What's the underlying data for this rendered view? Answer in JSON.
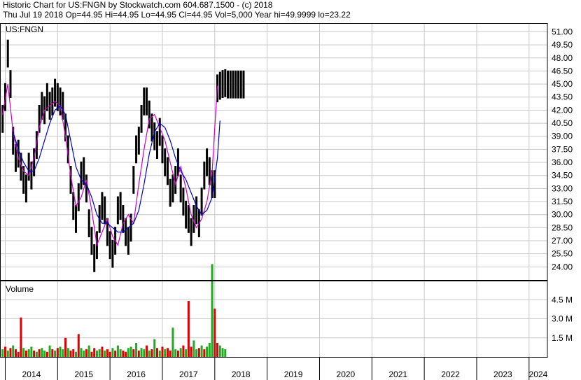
{
  "header": {
    "line1": "Historic Chart for US:FNGN by Stockwatch.com 604.687.1500 - (c) 2018",
    "line2": "Thu Jul 19 2018   Op=44.95  Hi=44.95  Lo=44.95  Cl=44.95  Vol=5,000   Year hi=49.9999   lo=23.22"
  },
  "price_panel": {
    "symbol_label": "US:FNGN"
  },
  "volume_panel": {
    "label": "Volume"
  },
  "colors": {
    "price_bars": "#000000",
    "ma_short": "#cc00cc",
    "ma_long": "#0000cc",
    "volume_up": "#22aa22",
    "volume_down": "#dd0000",
    "grid": "#c8c8c8",
    "frame": "#000000"
  },
  "chart_data": [
    {
      "type": "line",
      "title": "US:FNGN",
      "ylim": [
        22.5,
        52.0
      ],
      "y_ticks": [
        "51.00",
        "49.50",
        "48.00",
        "46.50",
        "45.00",
        "43.50",
        "42.00",
        "40.50",
        "39.00",
        "37.50",
        "36.00",
        "34.50",
        "33.00",
        "31.50",
        "30.00",
        "28.50",
        "27.00",
        "25.50",
        "24.00"
      ],
      "x_ticks": [
        "2014",
        "2015",
        "2016",
        "2017",
        "2018",
        "2019",
        "2020",
        "2021",
        "2022",
        "2023",
        "2024"
      ],
      "xlim": [
        2013.9,
        2024.35
      ],
      "grid": true,
      "series": [
        {
          "kind": "price",
          "x": [
            2013.95,
            2014.0,
            2014.05,
            2014.1,
            2014.15,
            2014.2,
            2014.25,
            2014.3,
            2014.35,
            2014.4,
            2014.45,
            2014.5,
            2014.55,
            2014.6,
            2014.65,
            2014.7,
            2014.75,
            2014.8,
            2014.85,
            2014.9,
            2014.95,
            2015.0,
            2015.05,
            2015.1,
            2015.15,
            2015.2,
            2015.25,
            2015.3,
            2015.35,
            2015.4,
            2015.45,
            2015.5,
            2015.55,
            2015.6,
            2015.65,
            2015.7,
            2015.75,
            2015.8,
            2015.85,
            2015.9,
            2015.95,
            2016.0,
            2016.05,
            2016.1,
            2016.15,
            2016.2,
            2016.25,
            2016.3,
            2016.35,
            2016.4,
            2016.45,
            2016.5,
            2016.55,
            2016.6,
            2016.65,
            2016.7,
            2016.75,
            2016.8,
            2016.85,
            2016.9,
            2016.95,
            2017.0,
            2017.05,
            2017.1,
            2017.15,
            2017.2,
            2017.25,
            2017.3,
            2017.35,
            2017.4,
            2017.45,
            2017.5,
            2017.55,
            2017.6,
            2017.65,
            2017.7,
            2017.75,
            2017.8,
            2017.85,
            2017.9,
            2017.95,
            2018.0,
            2018.05,
            2018.1,
            2018.15,
            2018.2,
            2018.25,
            2018.3,
            2018.35,
            2018.4,
            2018.45,
            2018.5,
            2018.55
          ],
          "values": [
            41.0,
            43.5,
            48.5,
            45.0,
            38.5,
            36.5,
            37.0,
            35.5,
            34.0,
            33.0,
            35.5,
            34.5,
            36.0,
            38.0,
            41.0,
            42.5,
            42.0,
            43.5,
            42.5,
            43.0,
            44.0,
            43.5,
            43.0,
            42.5,
            40.0,
            37.5,
            34.0,
            31.0,
            29.5,
            32.0,
            34.5,
            35.0,
            33.0,
            29.0,
            27.0,
            25.0,
            26.5,
            29.5,
            31.0,
            30.5,
            28.0,
            26.5,
            25.5,
            27.0,
            30.5,
            31.0,
            29.5,
            28.0,
            27.0,
            28.5,
            34.0,
            37.5,
            38.5,
            41.0,
            43.0,
            43.0,
            41.5,
            40.0,
            39.0,
            38.0,
            39.5,
            37.5,
            36.0,
            35.0,
            32.5,
            33.0,
            34.0,
            36.0,
            33.0,
            31.5,
            30.0,
            29.5,
            28.0,
            29.5,
            30.5,
            29.0,
            31.5,
            34.5,
            36.0,
            35.0,
            33.5,
            33.5,
            44.5,
            44.8,
            45.0,
            45.1,
            44.95,
            44.95,
            44.95,
            44.95,
            44.95,
            44.95,
            44.95
          ]
        },
        {
          "kind": "ma_short",
          "x": [
            2013.95,
            2014.05,
            2014.15,
            2014.25,
            2014.35,
            2014.45,
            2014.55,
            2014.65,
            2014.75,
            2014.85,
            2014.95,
            2015.05,
            2015.15,
            2015.25,
            2015.35,
            2015.45,
            2015.55,
            2015.65,
            2015.75,
            2015.85,
            2015.95,
            2016.05,
            2016.15,
            2016.25,
            2016.35,
            2016.45,
            2016.55,
            2016.65,
            2016.75,
            2016.85,
            2016.95,
            2017.05,
            2017.15,
            2017.25,
            2017.35,
            2017.45,
            2017.55,
            2017.65,
            2017.75,
            2017.85,
            2017.95,
            2018.0,
            2018.05
          ],
          "values": [
            41.5,
            45.0,
            39.5,
            36.5,
            35.0,
            34.5,
            36.5,
            40.0,
            42.0,
            42.5,
            43.0,
            42.5,
            39.0,
            34.5,
            31.0,
            32.0,
            34.0,
            30.5,
            26.5,
            28.0,
            29.5,
            27.5,
            26.5,
            29.0,
            30.0,
            29.0,
            33.5,
            37.5,
            41.0,
            41.5,
            40.0,
            38.5,
            36.0,
            33.5,
            35.5,
            33.0,
            30.0,
            28.5,
            29.5,
            31.5,
            35.0,
            40.0,
            44.8
          ]
        },
        {
          "kind": "ma_long",
          "x": [
            2014.15,
            2014.25,
            2014.35,
            2014.45,
            2014.55,
            2014.65,
            2014.75,
            2014.85,
            2014.95,
            2015.05,
            2015.15,
            2015.25,
            2015.35,
            2015.45,
            2015.55,
            2015.65,
            2015.75,
            2015.85,
            2015.95,
            2016.05,
            2016.15,
            2016.25,
            2016.35,
            2016.45,
            2016.55,
            2016.65,
            2016.75,
            2016.85,
            2016.95,
            2017.05,
            2017.15,
            2017.25,
            2017.35,
            2017.45,
            2017.55,
            2017.65,
            2017.75,
            2017.85,
            2017.95,
            2018.05,
            2018.1
          ],
          "values": [
            39.5,
            37.5,
            36.0,
            35.0,
            35.0,
            36.5,
            38.5,
            40.5,
            42.0,
            42.5,
            41.5,
            38.5,
            35.5,
            34.0,
            33.5,
            32.0,
            30.0,
            29.0,
            29.0,
            28.5,
            28.0,
            28.0,
            28.5,
            29.0,
            30.5,
            33.5,
            37.0,
            39.5,
            40.5,
            40.0,
            38.5,
            36.5,
            35.0,
            34.0,
            32.5,
            31.0,
            30.0,
            30.5,
            32.0,
            36.5,
            40.8
          ]
        }
      ]
    },
    {
      "type": "bar",
      "title": "Volume",
      "ylim": [
        0,
        6000000
      ],
      "y_ticks": [
        "4.5 M",
        "3.0 M",
        "1.5 M"
      ],
      "x": [
        2013.95,
        2014.0,
        2014.05,
        2014.1,
        2014.15,
        2014.2,
        2014.25,
        2014.3,
        2014.35,
        2014.4,
        2014.45,
        2014.5,
        2014.55,
        2014.6,
        2014.65,
        2014.7,
        2014.75,
        2014.8,
        2014.85,
        2014.9,
        2014.95,
        2015.0,
        2015.05,
        2015.1,
        2015.15,
        2015.2,
        2015.25,
        2015.3,
        2015.35,
        2015.4,
        2015.45,
        2015.5,
        2015.55,
        2015.6,
        2015.65,
        2015.7,
        2015.75,
        2015.8,
        2015.85,
        2015.9,
        2015.95,
        2016.0,
        2016.05,
        2016.1,
        2016.15,
        2016.2,
        2016.25,
        2016.3,
        2016.35,
        2016.4,
        2016.45,
        2016.5,
        2016.55,
        2016.6,
        2016.65,
        2016.7,
        2016.75,
        2016.8,
        2016.85,
        2016.9,
        2016.95,
        2017.0,
        2017.05,
        2017.1,
        2017.15,
        2017.2,
        2017.25,
        2017.3,
        2017.35,
        2017.4,
        2017.45,
        2017.5,
        2017.55,
        2017.6,
        2017.65,
        2017.7,
        2017.75,
        2017.8,
        2017.85,
        2017.9,
        2017.95,
        2018.0,
        2018.05,
        2018.1,
        2018.15,
        2018.2
      ],
      "values": [
        600000,
        800000,
        500000,
        700000,
        900000,
        600000,
        400000,
        3100000,
        700000,
        500000,
        600000,
        800000,
        500000,
        400000,
        600000,
        700000,
        500000,
        400000,
        900000,
        600000,
        500000,
        700000,
        800000,
        600000,
        1500000,
        700000,
        500000,
        600000,
        400000,
        1800000,
        700000,
        500000,
        600000,
        900000,
        400000,
        700000,
        500000,
        600000,
        800000,
        500000,
        600000,
        400000,
        700000,
        500000,
        900000,
        600000,
        500000,
        400000,
        700000,
        800000,
        600000,
        1100000,
        500000,
        700000,
        600000,
        900000,
        500000,
        600000,
        1400000,
        700000,
        500000,
        800000,
        600000,
        700000,
        500000,
        2300000,
        600000,
        500000,
        700000,
        900000,
        600000,
        4400000,
        800000,
        1300000,
        600000,
        700000,
        900000,
        600000,
        800000,
        1100000,
        7300000,
        3800000,
        1100000,
        900000,
        700000,
        600000
      ],
      "direction": [
        "u",
        "d",
        "u",
        "d",
        "u",
        "d",
        "d",
        "d",
        "u",
        "d",
        "u",
        "u",
        "d",
        "u",
        "d",
        "u",
        "u",
        "d",
        "u",
        "d",
        "u",
        "d",
        "u",
        "u",
        "d",
        "u",
        "d",
        "d",
        "u",
        "d",
        "u",
        "u",
        "d",
        "u",
        "d",
        "d",
        "u",
        "u",
        "d",
        "u",
        "d",
        "d",
        "u",
        "d",
        "u",
        "u",
        "d",
        "d",
        "u",
        "u",
        "d",
        "u",
        "d",
        "u",
        "u",
        "d",
        "u",
        "d",
        "u",
        "d",
        "u",
        "d",
        "u",
        "d",
        "d",
        "u",
        "u",
        "d",
        "u",
        "d",
        "u",
        "d",
        "d",
        "u",
        "u",
        "d",
        "u",
        "d",
        "u",
        "u",
        "u",
        "d",
        "d",
        "u",
        "u",
        "u"
      ]
    }
  ]
}
